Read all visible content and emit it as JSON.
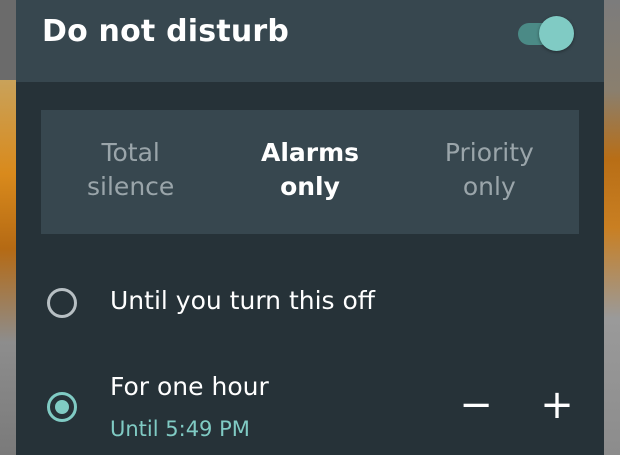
{
  "header": {
    "title": "Do not disturb",
    "toggle_on": true
  },
  "modes": [
    {
      "label": "Total\nsilence",
      "selected": false
    },
    {
      "label": "Alarms\nonly",
      "selected": true
    },
    {
      "label": "Priority\nonly",
      "selected": false
    }
  ],
  "duration_options": [
    {
      "label": "Until you turn this off",
      "selected": false
    },
    {
      "label": "For one hour",
      "sublabel": "Until 5:49 PM",
      "selected": true
    }
  ],
  "stepper": {
    "decrease_symbol": "−",
    "increase_symbol": "+"
  },
  "colors": {
    "accent": "#80cbc4",
    "panel": "#263238",
    "header": "#37474f"
  }
}
